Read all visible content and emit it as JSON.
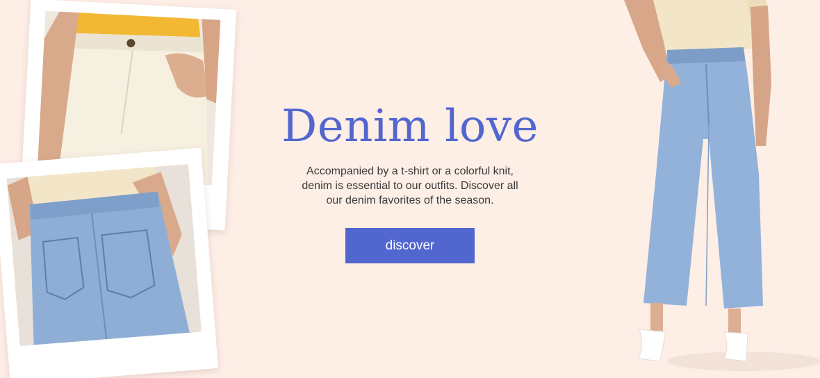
{
  "banner": {
    "headline": "Denim love",
    "body_lines": [
      "Accompanied by a t-shirt or a colorful knit,",
      "denim is essential to our outfits. Discover all",
      "our denim favorites of the season."
    ],
    "cta_label": "discover"
  },
  "colors": {
    "background": "#fdeee6",
    "accent": "#5266cf",
    "text": "#3b3b3b"
  }
}
